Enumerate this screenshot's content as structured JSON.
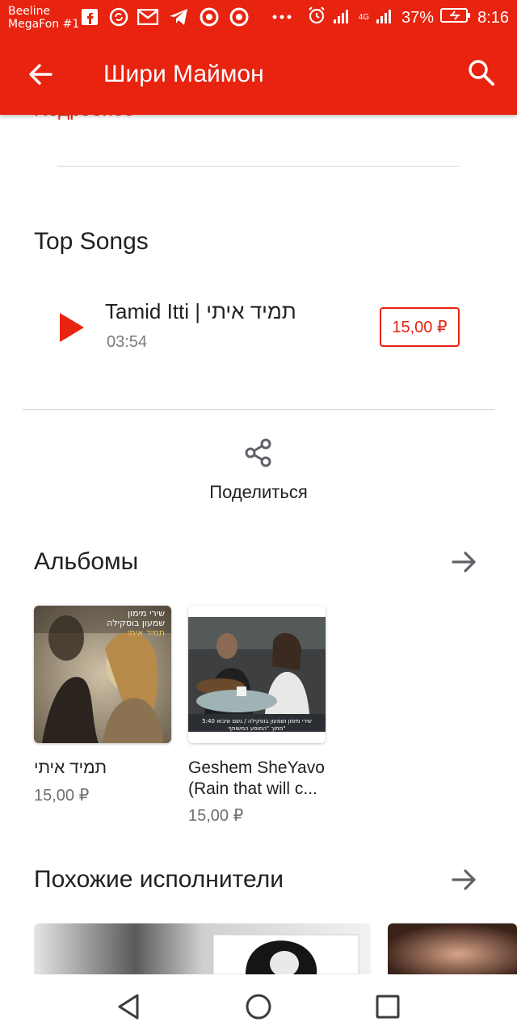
{
  "status_bar": {
    "carrier_line1": "Beeline",
    "carrier_line2": "MegaFon #1",
    "battery": "37%",
    "time": "8:16",
    "network": "4G",
    "icons": [
      "facebook-icon",
      "sync-icon",
      "mail-icon",
      "telegram-icon",
      "chrome-icon",
      "chrome-icon",
      "more-icon",
      "alarm-icon",
      "signal-icon",
      "signal-icon",
      "battery-charging-icon"
    ]
  },
  "app_bar": {
    "title": "Шири Маймон",
    "back_icon": "arrow-back-icon",
    "search_icon": "search-icon",
    "background": "#e8230f"
  },
  "more_link": "Подробнее",
  "top_songs": {
    "heading": "Top Songs",
    "songs": [
      {
        "title": "Tamid Itti | תמיד איתי",
        "duration": "03:54",
        "price": "15,00 ₽"
      }
    ]
  },
  "share": {
    "label": "Поделиться",
    "icon": "share-icon"
  },
  "albums": {
    "heading": "Альбомы",
    "items": [
      {
        "title": "תמיד איתי",
        "price": "15,00 ₽",
        "cover_text_1": "שירי מימון",
        "cover_text_2": "שמעון בוסקילה",
        "cover_text_3": "תמיד איתי"
      },
      {
        "title": "Geshem SheYavo (Rain that will c...",
        "price": "15,00 ₽",
        "cover_text_1": "שירי מימון ושמעון בוסקילה / גשם שיבוא 5:40",
        "cover_text_2": "מתוך \"המופע המשותף\""
      }
    ]
  },
  "similar_artists": {
    "heading": "Похожие исполнители"
  },
  "nav": {
    "back": "nav-back-icon",
    "home": "nav-home-icon",
    "recents": "nav-recents-icon"
  },
  "colors": {
    "accent": "#e8230f",
    "text": "#202124",
    "secondary": "#7a7a7a"
  }
}
